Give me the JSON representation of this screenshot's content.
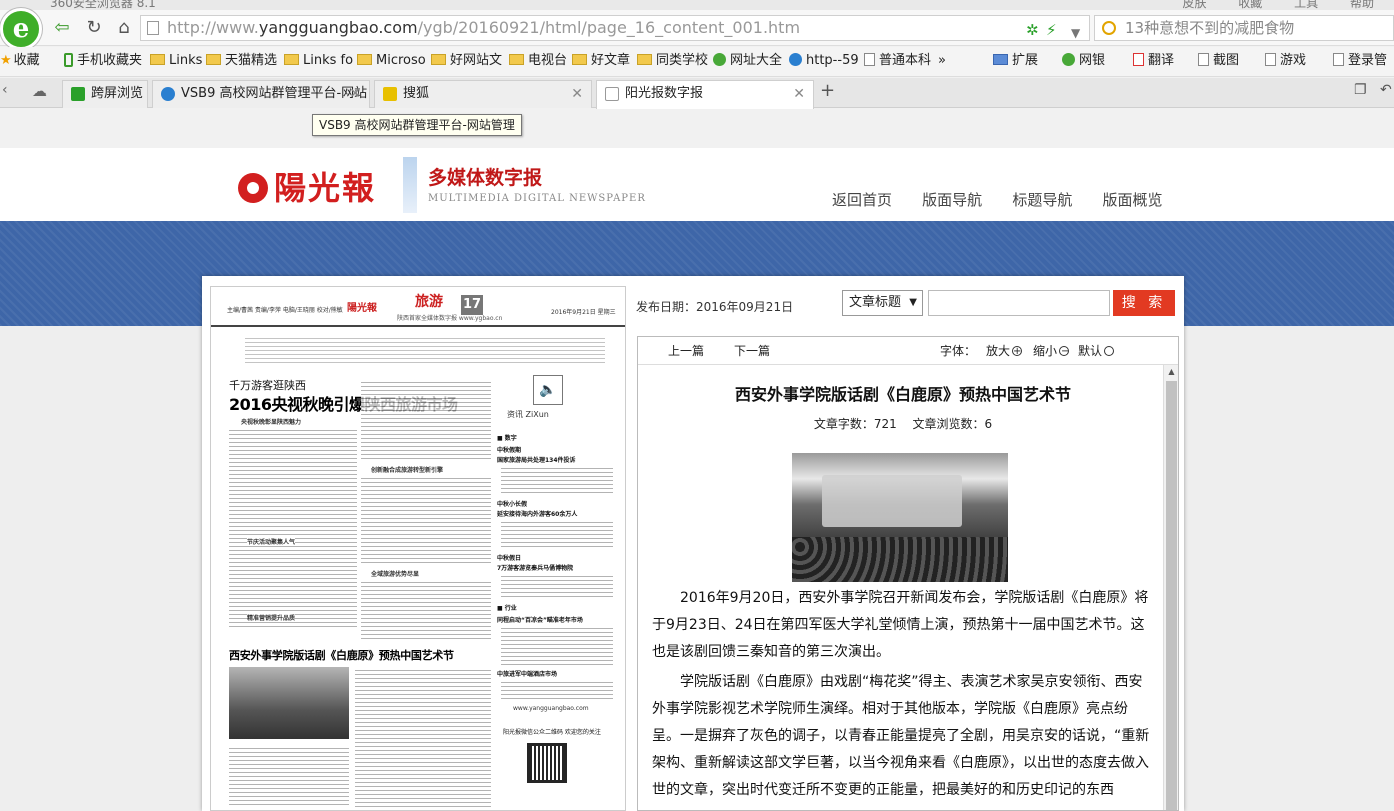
{
  "browser": {
    "title": "360安全浏览器 8.1",
    "title_menu": [
      "皮肤",
      "收藏",
      "工具",
      "帮助"
    ],
    "address": {
      "prefix": "http://www.",
      "domain": "yangguangbao.com",
      "path": "/ygb/20160921/html/page_16_content_001.htm"
    },
    "search_placeholder": "13种意想不到的减肥食物",
    "bookmarks": [
      "收藏",
      "手机收藏夹",
      "Links",
      "天猫精选",
      "Links fo",
      "Microso",
      "好网站文",
      "电视台",
      "好文章",
      "同类学校",
      "网址大全",
      "http--59",
      "普通本科",
      "»"
    ],
    "toolbar_right": [
      "扩展",
      "网银",
      "翻译",
      "截图",
      "游戏",
      "登录管"
    ],
    "tabs": [
      {
        "label": "跨屏浏览",
        "color": "#2aa02a"
      },
      {
        "label": "VSB9 高校网站群管理平台-网站",
        "color": "#2a7fd0"
      },
      {
        "label": "搜狐",
        "color": "#e8c000"
      },
      {
        "label": "阳光报数字报",
        "color": "#cccccc"
      }
    ],
    "tooltip": "VSB9 高校网站群管理平台-网站管理"
  },
  "site": {
    "brand": "陽光報",
    "brand_sub": "多媒体数字报",
    "brand_en": "MULTIMEDIA DIGITAL NEWSPAPER",
    "nav": [
      "返回首页",
      "版面导航",
      "标题导航",
      "版面概览"
    ]
  },
  "paper": {
    "header_left": "主编/曹茜 责编/李萍 电脑/王晓丽 校对/熊敏",
    "brand_mini": "陽光報",
    "section": "旅游",
    "section_sub": "陕西首家全媒体数字报 www.ygbao.cn",
    "page_no": "17",
    "date": "2016年9月21日 星期三",
    "kicker": "千万游客逛陕西",
    "headline": "2016央视秋晚引爆陕西旅游市场",
    "zixun": "资讯 ZiXun",
    "briefs": [
      "■ 数字",
      "中秋假期",
      "国家旅游局共处理134件投诉",
      "中秋小长假",
      "延安接待海内外游客60余万人",
      "中秋假日",
      "7万游客游览秦兵马俑博物院",
      "■ 行业",
      "同程启动“百凉会”瞄准老年市场",
      "中旅进军中端酒店市场"
    ],
    "subheads": [
      "央视秋晚彰显陕西魅力",
      "创新融合成旅游转型新引擎",
      "节庆活动聚集人气",
      "全域旅游优势尽显",
      "精准营销提升品质"
    ],
    "headline2": "西安外事学院版话剧《白鹿原》预热中国艺术节",
    "url": "www.yangguangbao.com",
    "qr_note": "阳光报微信公众二维码 欢迎您的关注"
  },
  "article": {
    "pubdate": "发布日期：2016年09月21日",
    "search_select": "文章标题",
    "search_button": "搜 索",
    "prev": "上一篇",
    "next": "下一篇",
    "font_label": "字体：",
    "font_big": "放大",
    "font_small": "缩小",
    "font_default": "默认",
    "title": "西安外事学院版话剧《白鹿原》预热中国艺术节",
    "word_count": "文章字数：721",
    "views": "文章浏览数：6",
    "para1": "2016年9月20日，西安外事学院召开新闻发布会，学院版话剧《白鹿原》将于9月23日、24日在第四军医大学礼堂倾情上演，预热第十一届中国艺术节。这也是该剧回馈三秦知音的第三次演出。",
    "para2": "学院版话剧《白鹿原》由戏剧“梅花奖”得主、表演艺术家吴京安领衔、西安外事学院影视艺术学院师生演绎。相对于其他版本，学院版《白鹿原》亮点纷呈。一是摒弃了灰色的调子，以青春正能量提亮了全剧，用吴京安的话说，“重新架构、重新解读这部文学巨著，以当今视角来看《白鹿原》，以出世的态度去做入世的文章，突出时代变迁所不变更的正能量，把最美好的和历史印记的东西"
  }
}
